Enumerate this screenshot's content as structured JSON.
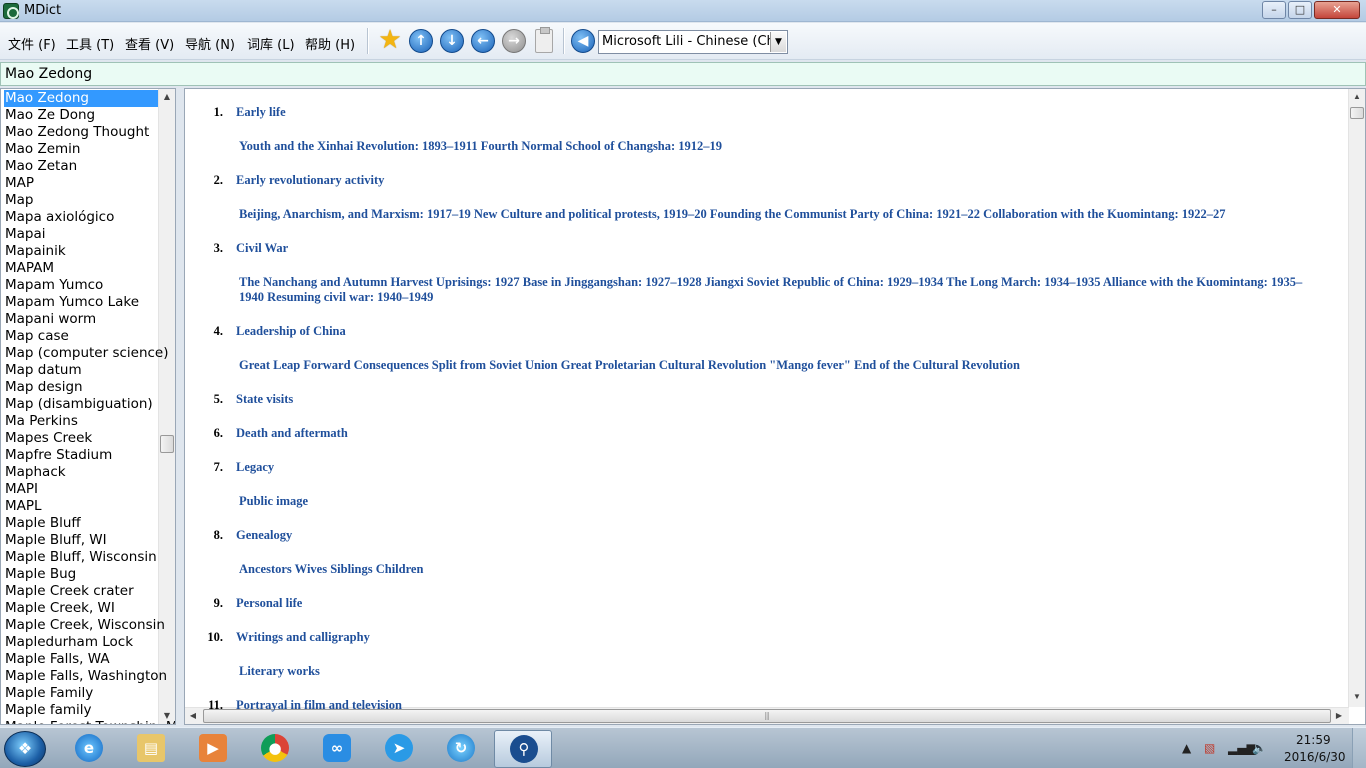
{
  "window": {
    "title": "MDict"
  },
  "menu": [
    "文件 (F)",
    "工具 (T)",
    "查看 (V)",
    "导航 (N)",
    "词库 (L)",
    "帮助 (H)"
  ],
  "toolbar": {
    "icons": [
      "star-icon",
      "arrow-up-icon",
      "arrow-down-icon",
      "back-icon",
      "forward-icon",
      "clipboard-icon",
      "speaker-icon"
    ],
    "voice_select": "Microsoft Lili - Chinese (China)"
  },
  "search": {
    "value": "Mao Zedong"
  },
  "word_list": [
    "Mao Zedong",
    "Mao Ze Dong",
    "Mao Zedong Thought",
    "Mao Zemin",
    "Mao Zetan",
    "MAP",
    "Map",
    "Mapa axiológico",
    "Mapai",
    "Mapainik",
    "MAPAM",
    "Mapam Yumco",
    "Mapam Yumco Lake",
    "Mapani worm",
    "Map case",
    "Map (computer science)",
    "Map datum",
    "Map design",
    "Map (disambiguation)",
    "Ma Perkins",
    "Mapes Creek",
    "Mapfre Stadium",
    "Maphack",
    "MAPI",
    "MAPL",
    "Maple Bluff",
    "Maple Bluff, WI",
    "Maple Bluff, Wisconsin",
    "Maple Bug",
    "Maple Creek crater",
    "Maple Creek, WI",
    "Maple Creek, Wisconsin",
    "Mapledurham Lock",
    "Maple Falls, WA",
    "Maple Falls, Washington",
    "Maple Family",
    "Maple family",
    "Maple Forest Township, Mi"
  ],
  "toc": [
    {
      "num": "1.",
      "title": "Early life",
      "subs": "Youth and the Xinhai Revolution: 1893–1911  Fourth Normal School of Changsha: 1912–19"
    },
    {
      "num": "2.",
      "title": "Early revolutionary activity",
      "subs": "Beijing, Anarchism, and Marxism: 1917–19  New Culture and political protests, 1919–20  Founding the Communist Party of China: 1921–22  Collaboration with the Kuomintang: 1922–27"
    },
    {
      "num": "3.",
      "title": "Civil War",
      "subs": "The Nanchang and Autumn Harvest Uprisings: 1927  Base in Jinggangshan: 1927–1928  Jiangxi Soviet Republic of China: 1929–1934  The Long March: 1934–1935  Alliance with the Kuomintang: 1935–1940  Resuming civil war: 1940–1949"
    },
    {
      "num": "4.",
      "title": "Leadership of China",
      "subs": "Great Leap Forward  Consequences  Split from Soviet Union  Great Proletarian Cultural Revolution  \"Mango fever\"  End of the Cultural Revolution"
    },
    {
      "num": "5.",
      "title": "State visits",
      "subs": ""
    },
    {
      "num": "6.",
      "title": "Death and aftermath",
      "subs": ""
    },
    {
      "num": "7.",
      "title": "Legacy",
      "subs": "Public image"
    },
    {
      "num": "8.",
      "title": "Genealogy",
      "subs": "Ancestors  Wives  Siblings  Children"
    },
    {
      "num": "9.",
      "title": "Personal life",
      "subs": ""
    },
    {
      "num": "10.",
      "title": "Writings and calligraphy",
      "subs": "Literary works"
    },
    {
      "num": "11.",
      "title": "Portrayal in film and television",
      "subs": ""
    }
  ],
  "taskbar": {
    "apps": [
      "internet-explorer-icon",
      "file-explorer-icon",
      "media-player-icon",
      "chrome-icon",
      "cloud-app-icon",
      "messenger-icon",
      "browser-swirl-icon",
      "mdict-icon"
    ]
  },
  "clock": {
    "time": "21:59",
    "date": "2016/6/30"
  }
}
